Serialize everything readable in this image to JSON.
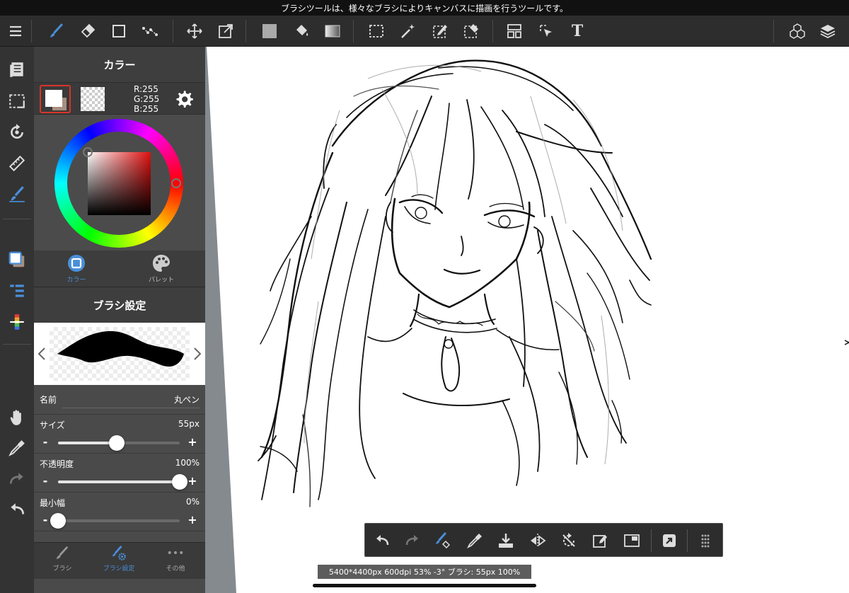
{
  "status_bar": {
    "tooltip": "ブラシツールは、様々なブラシによりキャンバスに描画を行うツールです。"
  },
  "toolbar": {
    "icons": [
      "menu-icon",
      "brush-icon",
      "eraser-icon",
      "rectangle-icon",
      "dot-icon",
      "move-icon",
      "transform-icon",
      "fill-icon",
      "bucket-icon",
      "gradient-icon",
      "select-rect-icon",
      "magic-wand-icon",
      "select-pen-icon",
      "select-eraser-icon",
      "frame-divide-icon",
      "operation-icon",
      "text-icon",
      "material-icon",
      "layers-icon"
    ],
    "text_tool_glyph": "T"
  },
  "color_panel": {
    "title": "カラー",
    "r": "R:255",
    "g": "G:255",
    "b": "B:255",
    "main_color": "#ffffff",
    "tabs": {
      "color": "カラー",
      "palette": "パレット"
    }
  },
  "brush_panel": {
    "title": "ブラシ設定",
    "name_label": "名前",
    "name_value": "丸ペン",
    "size_label": "サイズ",
    "size_value": "55px",
    "size_level": 0.48,
    "opacity_label": "不透明度",
    "opacity_value": "100%",
    "opacity_level": 1.0,
    "min_width_label": "最小幅",
    "min_width_value": "0%",
    "min_width_level": 0.0,
    "minus": "-",
    "plus": "+"
  },
  "bottom_tabs": {
    "brush": "ブラシ",
    "brush_settings": "ブラシ設定",
    "other": "その他",
    "other_glyph": "•••"
  },
  "status_info": "5400*4400px 600dpi 53% -3° ブラシ: 55px 100%",
  "colors": {
    "accent": "#4a8fd9",
    "toolbar_bg": "#2d2d2d",
    "panel_bg": "#4a4a4a",
    "selection_red": "#d9342b"
  }
}
